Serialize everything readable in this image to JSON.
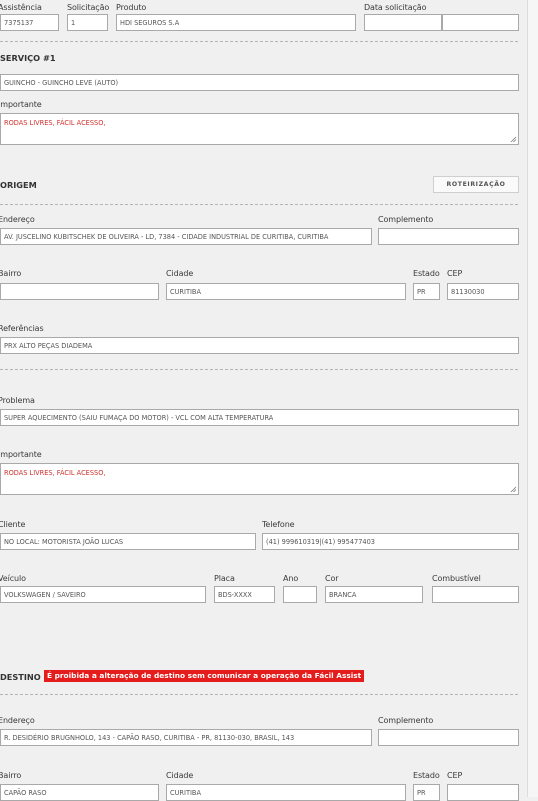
{
  "header": {
    "assistencia_label": "Assistência",
    "assistencia_value": "7375137",
    "solicitacao_label": "Solicitação",
    "solicitacao_value": "1",
    "produto_label": "Produto",
    "produto_value": "HDI SEGUROS S.A",
    "data_solicitacao_label": "Data solicitação",
    "data_solicitacao_value": "",
    "data_solicitacao_time": ""
  },
  "servico": {
    "title": "SERVIÇO #1",
    "tipo_value": "GUINCHO - GUINCHO LEVE (AUTO)",
    "importante_label": "Importante",
    "importante_value": "RODAS LIVRES, FÁCIL ACESSO,"
  },
  "origem": {
    "title": "ORIGEM",
    "roteirizacao_label": "ROTEIRIZAÇÃO",
    "endereco_label": "Endereço",
    "endereco_value": "AV. JUSCELINO KUBITSCHEK DE OLIVEIRA - LD, 7384 - CIDADE INDUSTRIAL DE CURITIBA, CURITIBA",
    "complemento_label": "Complemento",
    "complemento_value": "",
    "bairro_label": "Bairro",
    "bairro_value": "",
    "cidade_label": "Cidade",
    "cidade_value": "CURITIBA",
    "estado_label": "Estado",
    "estado_value": "PR",
    "cep_label": "CEP",
    "cep_value": "81130030",
    "referencias_label": "Referências",
    "referencias_value": "PRX ALTO PEÇAS DIADEMA"
  },
  "ocorrencia": {
    "problema_label": "Problema",
    "problema_value": "SUPER AQUECIMENTO (SAIU FUMAÇA DO MOTOR) - VCL COM ALTA TEMPERATURA",
    "importante_label": "Importante",
    "importante_value": "RODAS LIVRES, FÁCIL ACESSO,",
    "cliente_label": "Cliente",
    "cliente_value": "NO LOCAL: MOTORISTA JOÃO LUCAS",
    "telefone_label": "Telefone",
    "telefone_value": "(41) 999610319|(41) 995477403"
  },
  "veiculo": {
    "veiculo_label": "Veículo",
    "veiculo_value": "VOLKSWAGEN / SAVEIRO",
    "placa_label": "Placa",
    "placa_value": "BDS-XXXX",
    "ano_label": "Ano",
    "ano_value": "",
    "cor_label": "Cor",
    "cor_value": "BRANCA",
    "combustivel_label": "Combustível",
    "combustivel_value": ""
  },
  "destino": {
    "title": "DESTINO",
    "warning": "É proibida a alteração de destino sem comunicar a operação da Fácil Assist",
    "endereco_label": "Endereço",
    "endereco_value": "R. DESIDÉRIO BRUGNHOLO, 143 - CAPÃO RASO, CURITIBA - PR, 81130-030, BRASIL, 143",
    "complemento_label": "Complemento",
    "complemento_value": "",
    "bairro_label": "Bairro",
    "bairro_value": "CAPÃO RASO",
    "cidade_label": "Cidade",
    "cidade_value": "CURITIBA",
    "estado_label": "Estado",
    "estado_value": "PR",
    "cep_label": "CEP",
    "cep_value": ""
  },
  "colors": {
    "background": "#f0f0f0",
    "warning_bg": "#e41c1c",
    "important_text": "#d0312d"
  }
}
